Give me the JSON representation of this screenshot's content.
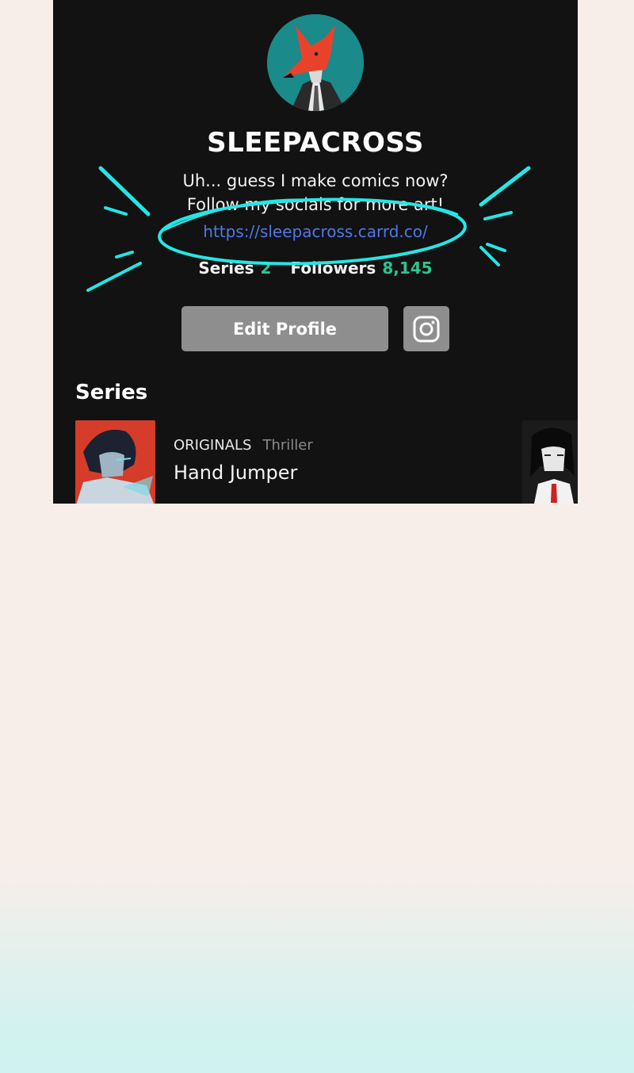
{
  "profile": {
    "username": "SLEEPACROSS",
    "bio_line1": "Uh... guess I make comics now?",
    "bio_line2": "Follow my socials for more art!",
    "link": "https://sleepacross.carrd.co/",
    "stats": {
      "series_label": "Series",
      "series_count": "2",
      "followers_label": "Followers",
      "followers_count": "8,145"
    },
    "avatar_icon": "fox-avatar"
  },
  "actions": {
    "edit_profile_label": "Edit Profile",
    "instagram_icon": "instagram-icon"
  },
  "series_section": {
    "title": "Series",
    "items": [
      {
        "badge": "ORIGINALS",
        "genre": "Thriller",
        "name": "Hand Jumper"
      }
    ]
  },
  "colors": {
    "background": "#121212",
    "link": "#4f78e8",
    "stat_number": "#2dc58e",
    "button": "#8e8e8e",
    "annotation": "#25e6e6"
  }
}
